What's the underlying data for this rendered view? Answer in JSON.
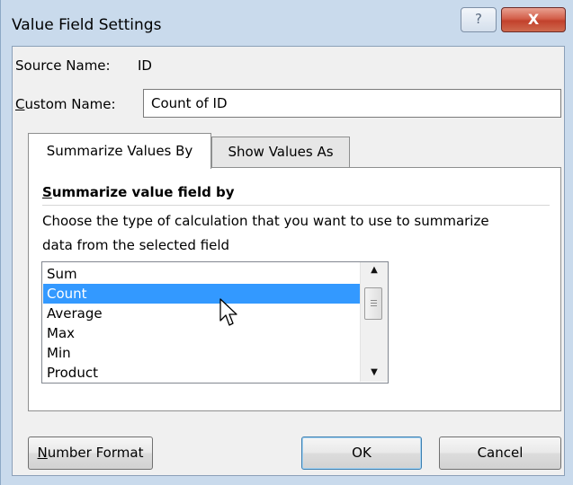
{
  "window": {
    "title": "Value Field Settings",
    "help_label": "?",
    "close_label": "X"
  },
  "source": {
    "label": "Source Name:",
    "value": "ID"
  },
  "custom_name": {
    "label_accel": "C",
    "label_rest": "ustom Name:",
    "value": "Count of ID"
  },
  "tabs": [
    {
      "label": "Summarize Values By",
      "active": true
    },
    {
      "label": "Show Values As",
      "active": false
    }
  ],
  "summarize": {
    "heading_accel": "S",
    "heading_rest": "ummarize value field by",
    "description_line1": "Choose the type of calculation that you want to use to summarize",
    "description_line2": "data from the selected field",
    "options": [
      "Sum",
      "Count",
      "Average",
      "Max",
      "Min",
      "Product"
    ],
    "selected": "Count"
  },
  "buttons": {
    "number_format_accel": "N",
    "number_format_rest": "umber Format",
    "ok": "OK",
    "cancel": "Cancel"
  },
  "colors": {
    "selection": "#3399ff",
    "frame": "#c9daec",
    "close_button": "#c2412c"
  },
  "icons": {
    "help": "question-mark-icon",
    "close": "close-x-icon",
    "scroll_up": "triangle-up-icon",
    "scroll_down": "triangle-down-icon",
    "cursor": "mouse-pointer-icon"
  }
}
